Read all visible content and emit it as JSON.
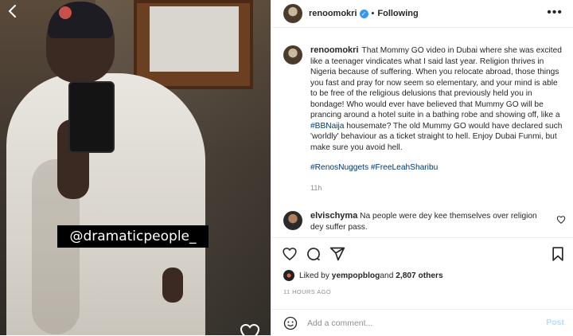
{
  "media": {
    "watermark_text": "@dramaticpeople_",
    "back_icon": "chevron-left-icon",
    "heart_icon": "heart-outline-icon"
  },
  "header": {
    "username": "renoomokri",
    "separator": "•",
    "follow_status": "Following",
    "more_icon": "more-horizontal-icon",
    "more_label": "•••"
  },
  "caption": {
    "username": "renoomokri",
    "text_part1": "That Mommy GO video in Dubai where she was excited like a teenager vindicates what I said last year. Religion thrives in Nigeria because of suffering. When you relocate abroad, those things you fast and pray for now seem so elementary, and your mind is able to be free of the religious delusions that previously held you in bondage! Who would ever have believed that Mummy GO will be prancing around a hotel suite in a bathing robe and showing off, like a ",
    "text_hashtag": "#BBNaija",
    "text_part2": " housemate? The old Mummy GO would have declared such 'worldly' behaviour as a ticket straight to hell. Enjoy Dubai Funmi, but make sure you avoid hell.",
    "hashtags": "#RenosNuggets #FreeLeahSharibu",
    "time": "11h"
  },
  "comment": {
    "username": "elvischyma",
    "text": "Na people were dey kee themselves over religion dey suffer pass."
  },
  "actions": {
    "like_icon": "heart-icon",
    "comment_icon": "comment-icon",
    "share_icon": "paper-plane-icon",
    "save_icon": "bookmark-icon"
  },
  "likes": {
    "prefix": "Liked by ",
    "user": "yempopblog",
    "middle": " and ",
    "others": "2,807 others"
  },
  "post_time": "11 HOURS AGO",
  "add_comment": {
    "placeholder": "Add a comment...",
    "post_label": "Post",
    "emoji_icon": "smiley-icon"
  },
  "colors": {
    "link": "#00376b",
    "verified": "#3897f0",
    "muted": "#8e8e8e",
    "post_button": "#b2dffc",
    "border": "#efefef"
  }
}
